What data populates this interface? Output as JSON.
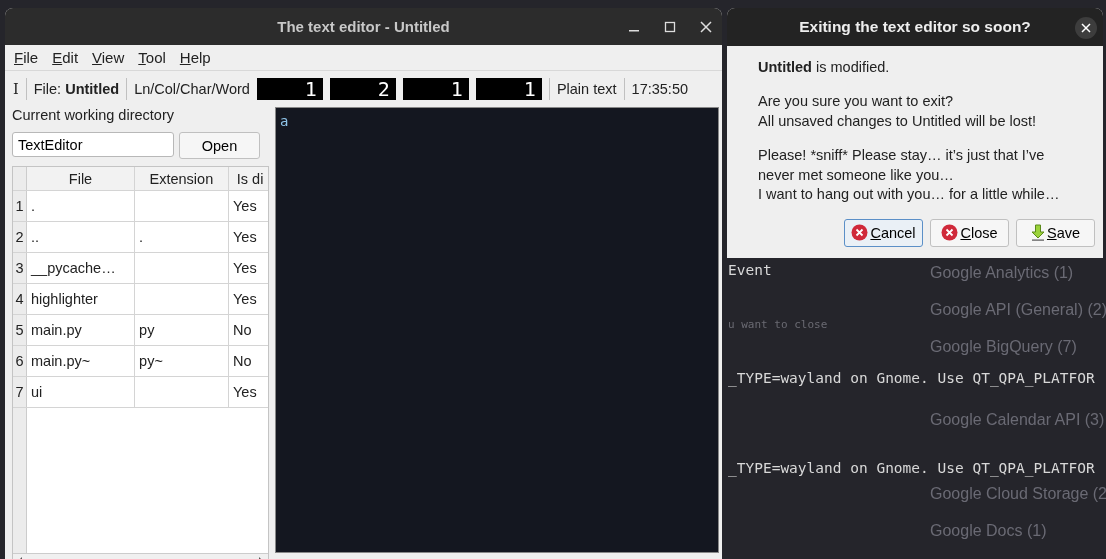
{
  "main_window": {
    "title": "The text editor - Untitled",
    "menu": [
      "File",
      "Edit",
      "View",
      "Tool",
      "Help"
    ],
    "toolbar": {
      "cursor_glyph": "I",
      "file_label": "File:",
      "file_name": "Untitled",
      "position_label": "Ln/Col/Char/Word",
      "counters": [
        "1",
        "2",
        "1",
        "1"
      ],
      "syntax": "Plain text",
      "clock": "17:35:50"
    },
    "sidebar": {
      "directory_label": "Current working directory",
      "directory_value": "TextEditor",
      "open_button": "Open",
      "table": {
        "columns": [
          "File",
          "Extension",
          "Is di"
        ],
        "rows": [
          {
            "number": "1",
            "file": ".",
            "column_3": "Yes"
          },
          {
            "number": "2",
            "file": "..",
            "extension": ".",
            "column_3": "Yes"
          },
          {
            "number": "3",
            "file": "__pycache…",
            "column_3": "Yes"
          },
          {
            "number": "4",
            "file": "highlighter",
            "column_3": "Yes"
          },
          {
            "number": "5",
            "file": "main.py",
            "extension": "py",
            "column_3": "No"
          },
          {
            "number": "6",
            "file": "main.py~",
            "extension": "py~",
            "column_3": "No"
          },
          {
            "number": "7",
            "file": "ui",
            "column_3": "Yes"
          }
        ]
      }
    },
    "editor": {
      "text": "a"
    }
  },
  "dialog": {
    "title": "Exiting the text editor so soon?",
    "message": "**Untitled** is modified.",
    "paragraphs": [
      [
        "Are you sure you want to exit?",
        "All unsaved changes to Untitled will be lost!"
      ],
      [
        "Please! *sniff* Please stay… it’s just that I’ve",
        "never met someone like you…",
        "I want to hang out with you… for a little while…"
      ]
    ],
    "buttons": [
      {
        "label": "Cancel",
        "kind": "cancel",
        "focused": true
      },
      {
        "label": "Close",
        "kind": "close",
        "focused": false
      },
      {
        "label": "Save",
        "kind": "save",
        "focused": false
      }
    ]
  },
  "background_terminal": {
    "lines": [
      {
        "text": "Event",
        "dim": false
      },
      {
        "text": "u want to close",
        "dim": true
      },
      {
        "text": "_TYPE=wayland on Gnome. Use QT_QPA_PLATFOR",
        "dim": false
      },
      {
        "text": "_TYPE=wayland on Gnome. Use QT_QPA_PLATFOR",
        "dim": false
      }
    ]
  },
  "background_list": {
    "items": [
      "Google Analytics (1)",
      "Google API (General) (2)",
      "Google BigQuery (7)",
      "Google Calendar API (3)",
      "Google Cloud Storage (2",
      "Google Docs (1)"
    ]
  }
}
